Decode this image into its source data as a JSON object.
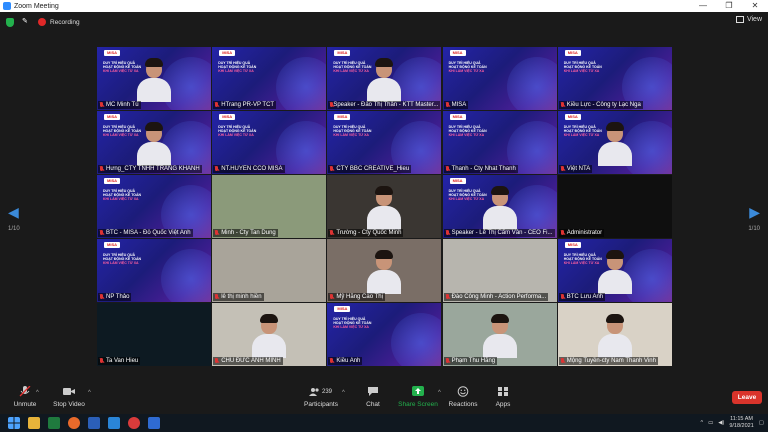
{
  "window": {
    "title": "Zoom Meeting",
    "minimize": "—",
    "maximize": "❐",
    "close": "✕"
  },
  "topbar": {
    "recording_label": "Recording",
    "view_label": "View"
  },
  "nav": {
    "left_arrow": "◀",
    "right_arrow": "▶",
    "page_left": "1/10",
    "page_right": "1/10"
  },
  "banner": {
    "logo": "MISA",
    "line1": "DUY TRÌ HIỆU QUẢ",
    "line2": "HOẠT ĐỘNG KẾ TOÁN",
    "line3": "KHI LÀM VIỆC TỪ XA"
  },
  "tiles": [
    {
      "name": "MC Minh Tú",
      "type": "banner",
      "person": true
    },
    {
      "name": "HTrang PR-VP TCT",
      "type": "banner",
      "person": false
    },
    {
      "name": "Speaker - Đào Thị Thân - KTT Master...",
      "type": "banner",
      "person": true,
      "active": true
    },
    {
      "name": "MISA",
      "type": "banner",
      "person": false
    },
    {
      "name": "Kiều Lực - Công ty Lạc Nga",
      "type": "banner",
      "person": false
    },
    {
      "name": "Hưng_CTY TNHH TRANG KHANH",
      "type": "banner",
      "person": true
    },
    {
      "name": "NT.HUYEN CCO MISA",
      "type": "banner",
      "person": false
    },
    {
      "name": "CTY BBC CREATIVE_Hieu",
      "type": "banner",
      "person": false
    },
    {
      "name": "Thanh - Cty Nhat Thanh",
      "type": "banner",
      "person": false
    },
    {
      "name": "Việt NTA",
      "type": "banner",
      "person": true
    },
    {
      "name": "BTC - MISA - Đỗ Quốc Việt Anh",
      "type": "banner",
      "person": false
    },
    {
      "name": "Minh - Cty Tan Dung",
      "type": "video",
      "bg": "#8b9a7a",
      "person": false
    },
    {
      "name": "Trường - Cty Quốc Minh",
      "type": "video",
      "bg": "#3a3632",
      "person": true
    },
    {
      "name": "Speaker - Lê Thị Cẩm Vân - CEO Fi...",
      "type": "banner",
      "person": true
    },
    {
      "name": "Administrator",
      "type": "dark"
    },
    {
      "name": "NP Thảo",
      "type": "banner",
      "person": false
    },
    {
      "name": "lê thị minh hiền",
      "type": "video",
      "bg": "#a9a49a",
      "person": false
    },
    {
      "name": "Mỹ Hằng Cao Thị",
      "type": "video",
      "bg": "#7a6e66",
      "person": true
    },
    {
      "name": "Đào Công Minh - Action Performa...",
      "type": "video",
      "bg": "#b7b5ae",
      "person": false
    },
    {
      "name": "BTC Lưu Anh",
      "type": "banner",
      "person": true
    },
    {
      "name": "Ta Van Hieu",
      "type": "video",
      "bg": "#0d1a22",
      "person": false
    },
    {
      "name": "CHU ĐỨC ANH MINH",
      "type": "video",
      "bg": "#c4c0b6",
      "person": true
    },
    {
      "name": "Kiều Anh",
      "type": "banner",
      "person": false
    },
    {
      "name": "Phạm Thu Hằng",
      "type": "video",
      "bg": "#9aa79c",
      "person": true
    },
    {
      "name": "Mộng Tuyền-cty Nam Thanh Vinh",
      "type": "video",
      "bg": "#d9d2c6",
      "person": true
    }
  ],
  "controls": {
    "unmute": "Unmute",
    "stop_video": "Stop Video",
    "participants": "Participants",
    "participants_count": "239",
    "chat": "Chat",
    "share_screen": "Share Screen",
    "reactions": "Reactions",
    "apps": "Apps",
    "leave": "Leave"
  },
  "taskbar": {
    "time": "11:15 AM",
    "date": "9/18/2021"
  },
  "colors": {
    "accent_blue": "#2d8cff",
    "leave_red": "#d9342b",
    "share_green": "#23b14d",
    "active_speaker": "#d6d84a"
  }
}
